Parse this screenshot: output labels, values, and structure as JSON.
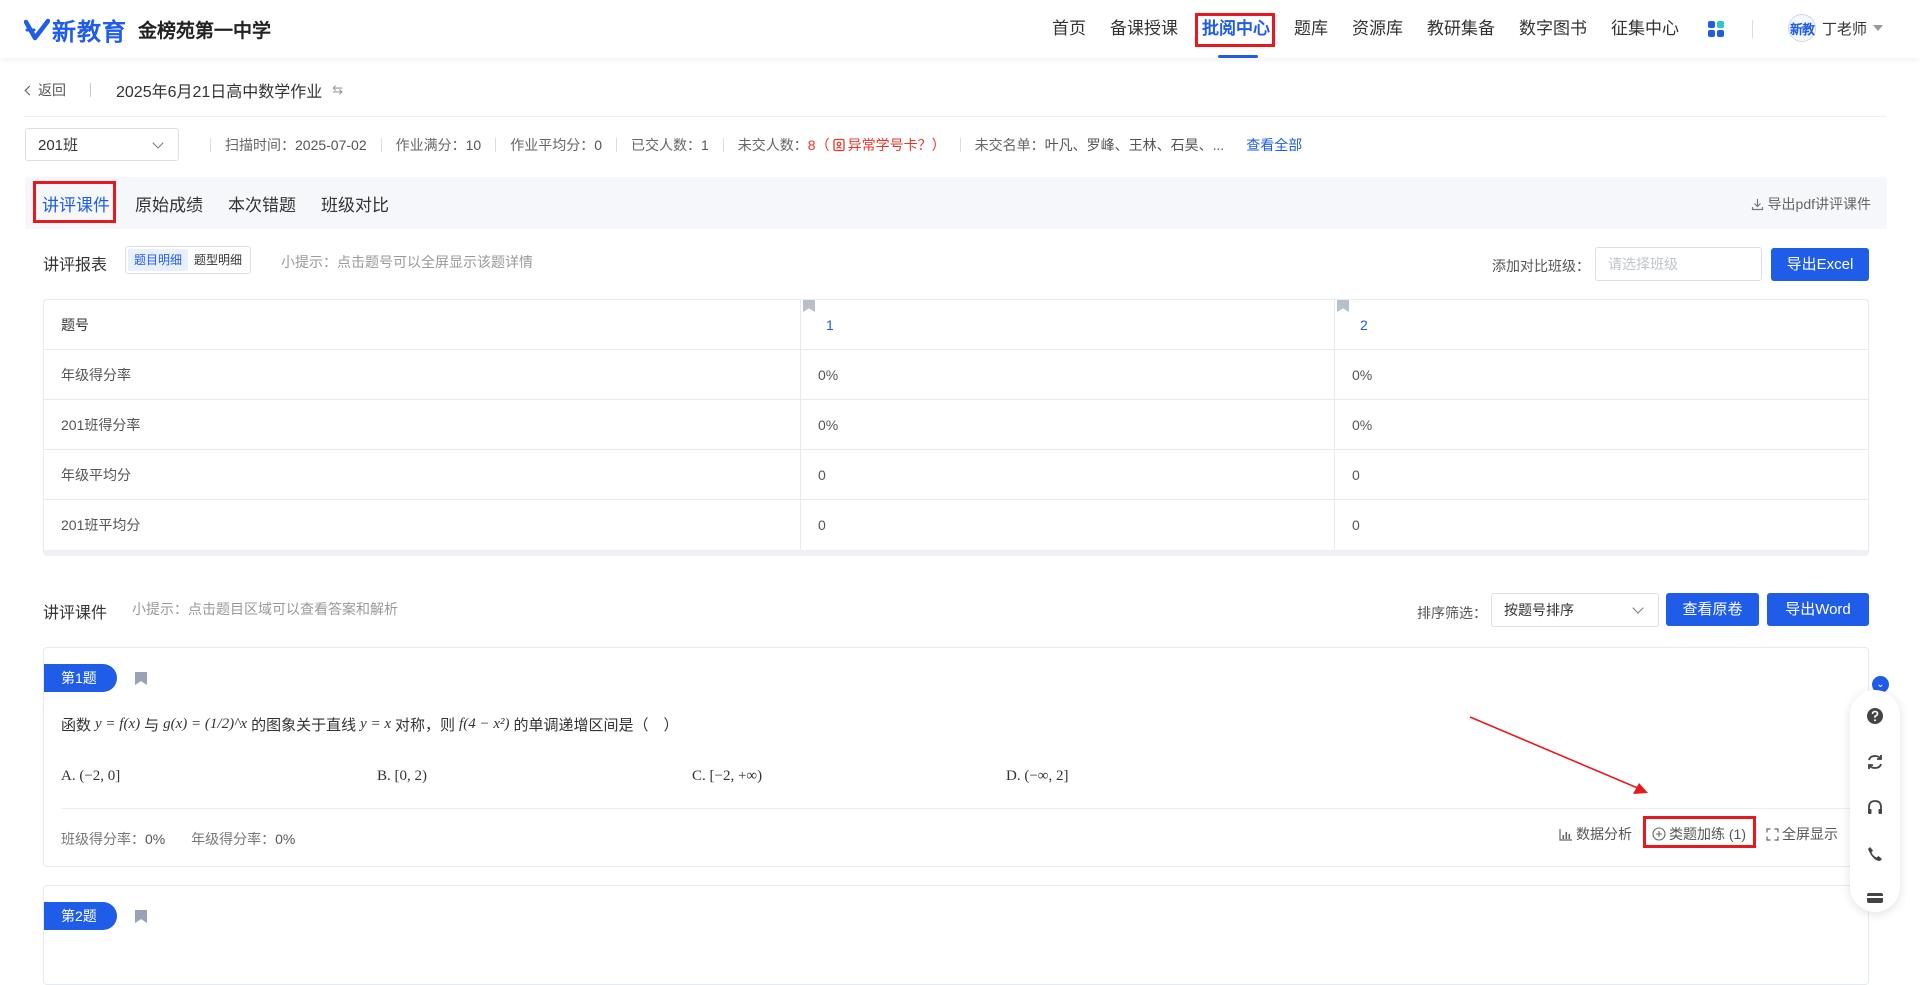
{
  "header": {
    "brand": "新教育",
    "school": "金榜苑第一中学",
    "nav": [
      "首页",
      "备课授课",
      "批阅中心",
      "题库",
      "资源库",
      "教研集备",
      "数字图书",
      "征集中心"
    ],
    "active_nav": "批阅中心",
    "user_avatar": "新教",
    "user_name": "丁老师"
  },
  "breadcrumb": {
    "back": "返回",
    "title": "2025年6月21日高中数学作业"
  },
  "filter": {
    "class": "201班",
    "scan_time_label": "扫描时间：",
    "scan_time": "2025-07-02",
    "full_score_label": "作业满分：",
    "full_score": "10",
    "avg_label": "作业平均分：",
    "avg": "0",
    "submitted_label": "已交人数：",
    "submitted": "1",
    "unsubmitted_label": "未交人数：",
    "unsubmitted": "8（",
    "abnormal": "异常学号卡？）",
    "unsubmitted_list_label": "未交名单：",
    "unsubmitted_list": "叶凡、罗峰、王林、石昊、...",
    "view_all": "查看全部"
  },
  "tabs": [
    "讲评课件",
    "原始成绩",
    "本次错题",
    "班级对比"
  ],
  "export_pdf": "导出pdf讲评课件",
  "report": {
    "title": "讲评报表",
    "toggle": [
      "题目明细",
      "题型明细"
    ],
    "hint": "小提示：点击题号可以全屏显示该题详情",
    "compare_label": "添加对比班级：",
    "compare_placeholder": "请选择班级",
    "export_excel": "导出Excel",
    "columns": [
      "题号",
      "1",
      "2"
    ],
    "rows": [
      [
        "年级得分率",
        "0%",
        "0%"
      ],
      [
        "201班得分率",
        "0%",
        "0%"
      ],
      [
        "年级平均分",
        "0",
        "0"
      ],
      [
        "201班平均分",
        "0",
        "0"
      ]
    ]
  },
  "lecture": {
    "title": "讲评课件",
    "hint": "小提示：点击题目区域可以查看答案和解析",
    "sort_label": "排序筛选：",
    "sort_value": "按题号排序",
    "view_original": "查看原卷",
    "export_word": "导出Word"
  },
  "question1": {
    "tag": "第1题",
    "text_parts": [
      "函数",
      "y = f(x)",
      "与",
      "g(x) = (1/2)^x",
      "的图象关于直线",
      "y = x",
      "对称，则",
      "f(4 − x²)",
      "的单调递增区间是（　）"
    ],
    "options": [
      "A. (−2, 0]",
      "B. [0, 2)",
      "C. [−2, +∞)",
      "D. (−∞, 2]"
    ],
    "class_rate_label": "班级得分率：",
    "class_rate": "0%",
    "grade_rate_label": "年级得分率：",
    "grade_rate": "0%",
    "actions": [
      "数据分析",
      "类题加练 (1)",
      "全屏显示"
    ]
  },
  "question2": {
    "tag": "第2题"
  },
  "colors": {
    "accent": "#1f5ce8",
    "highlight": "#e8191d"
  }
}
